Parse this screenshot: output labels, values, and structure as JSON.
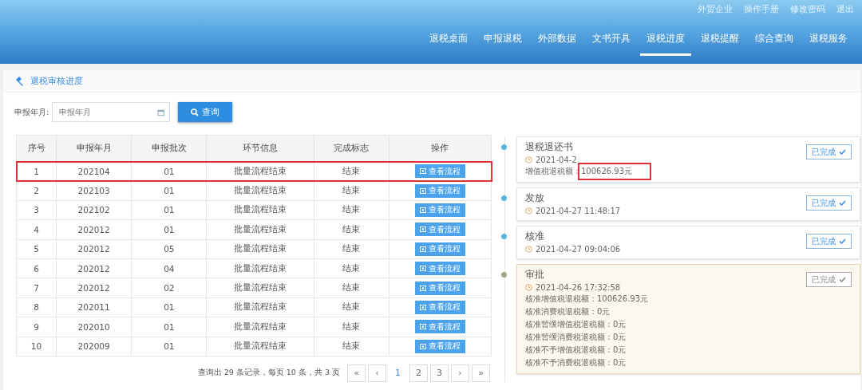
{
  "top_links": [
    "外贸企业",
    "操作手册",
    "修改密码",
    "退出"
  ],
  "nav": [
    {
      "label": "退税桌面",
      "selected": false
    },
    {
      "label": "申报退税",
      "selected": false
    },
    {
      "label": "外部数据",
      "selected": false
    },
    {
      "label": "文书开具",
      "selected": false
    },
    {
      "label": "退税进度",
      "selected": true
    },
    {
      "label": "退税提醒",
      "selected": false
    },
    {
      "label": "综合查询",
      "selected": false
    },
    {
      "label": "退税服务",
      "selected": false
    }
  ],
  "panel_title": "退税审核进度",
  "search": {
    "label": "申报年月:",
    "placeholder": "申报年月",
    "button": "查询"
  },
  "table": {
    "columns": [
      "序号",
      "申报年月",
      "申报批次",
      "环节信息",
      "完成标志",
      "操作"
    ],
    "rows": [
      {
        "cells": [
          "1",
          "202104",
          "01",
          "批量流程结束",
          "结束"
        ],
        "action": "查看流程",
        "highlighted": true
      },
      {
        "cells": [
          "2",
          "202103",
          "01",
          "批量流程结束",
          "结束"
        ],
        "action": "查看流程",
        "highlighted": false
      },
      {
        "cells": [
          "3",
          "202102",
          "01",
          "批量流程结束",
          "结束"
        ],
        "action": "查看流程",
        "highlighted": false
      },
      {
        "cells": [
          "4",
          "202012",
          "01",
          "批量流程结束",
          "结束"
        ],
        "action": "查看流程",
        "highlighted": false
      },
      {
        "cells": [
          "5",
          "202012",
          "05",
          "批量流程结束",
          "结束"
        ],
        "action": "查看流程",
        "highlighted": false
      },
      {
        "cells": [
          "6",
          "202012",
          "04",
          "批量流程结束",
          "结束"
        ],
        "action": "查看流程",
        "highlighted": false
      },
      {
        "cells": [
          "7",
          "202012",
          "02",
          "批量流程结束",
          "结束"
        ],
        "action": "查看流程",
        "highlighted": false
      },
      {
        "cells": [
          "8",
          "202011",
          "01",
          "批量流程结束",
          "结束"
        ],
        "action": "查看流程",
        "highlighted": false
      },
      {
        "cells": [
          "9",
          "202010",
          "01",
          "批量流程结束",
          "结束"
        ],
        "action": "查看流程",
        "highlighted": false
      },
      {
        "cells": [
          "10",
          "202009",
          "01",
          "批量流程结束",
          "结束"
        ],
        "action": "查看流程",
        "highlighted": false
      }
    ]
  },
  "pagination": {
    "summary": "查询出 29 条记录，每页 10 条，共 3 页",
    "buttons": [
      {
        "label": "«",
        "selected": false
      },
      {
        "label": "‹",
        "selected": false
      },
      {
        "label": "1",
        "selected": true
      },
      {
        "label": "2",
        "selected": false
      },
      {
        "label": "3",
        "selected": false
      },
      {
        "label": "›",
        "selected": false
      },
      {
        "label": "»",
        "selected": false
      }
    ]
  },
  "timeline": [
    {
      "title": "退税退还书",
      "time": "2021-04-2",
      "status": "已完成",
      "current": false,
      "color": "#5bb3e0",
      "details": [
        {
          "label": "增值税退税额：",
          "value": "100626.93元",
          "highlighted": true
        }
      ]
    },
    {
      "title": "发放",
      "time": "2021-04-27 11:48:17",
      "status": "已完成",
      "current": false,
      "color": "#5bb3e0"
    },
    {
      "title": "核准",
      "time": "2021-04-27 09:04:06",
      "status": "已完成",
      "current": false,
      "color": "#5bb3e0"
    },
    {
      "title": "审批",
      "time": "2021-04-26 17:32:58",
      "status": "已完成",
      "current": true,
      "color": "#9aa88a",
      "details": [
        {
          "label": "核准增值税退税额：",
          "value": "100626.93元",
          "highlighted": false
        },
        {
          "label": "核准消费税退税额：",
          "value": "0元",
          "highlighted": false
        },
        {
          "label": "核准暂缓增值税退税额：",
          "value": "0元",
          "highlighted": false
        },
        {
          "label": "核准暂缓消费税退税额：",
          "value": "0元",
          "highlighted": false
        },
        {
          "label": "核准不予增值税退税额：",
          "value": "0元",
          "highlighted": false
        },
        {
          "label": "核准不予消费税退税额：",
          "value": "0元",
          "highlighted": false
        }
      ]
    }
  ]
}
